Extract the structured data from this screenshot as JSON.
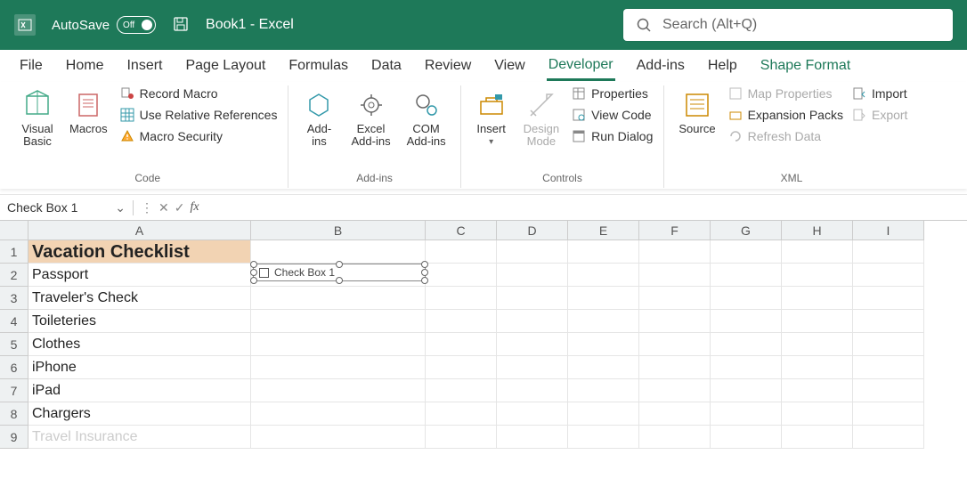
{
  "titlebar": {
    "autosave_label": "AutoSave",
    "autosave_state": "Off",
    "doc_name": "Book1",
    "app_name": "Excel",
    "separator": " - "
  },
  "search": {
    "placeholder": "Search (Alt+Q)"
  },
  "tabs": {
    "file": "File",
    "home": "Home",
    "insert": "Insert",
    "page_layout": "Page Layout",
    "formulas": "Formulas",
    "data": "Data",
    "review": "Review",
    "view": "View",
    "developer": "Developer",
    "addins": "Add-ins",
    "help": "Help",
    "shape_format": "Shape Format"
  },
  "ribbon": {
    "code": {
      "visual_basic": "Visual\nBasic",
      "macros": "Macros",
      "record_macro": "Record Macro",
      "use_relative": "Use Relative References",
      "macro_security": "Macro Security",
      "group": "Code"
    },
    "addins": {
      "addins": "Add-\nins",
      "excel_addins": "Excel\nAdd-ins",
      "com_addins": "COM\nAdd-ins",
      "group": "Add-ins"
    },
    "controls": {
      "insert": "Insert",
      "design_mode": "Design\nMode",
      "properties": "Properties",
      "view_code": "View Code",
      "run_dialog": "Run Dialog",
      "group": "Controls"
    },
    "xml": {
      "source": "Source",
      "map_properties": "Map Properties",
      "expansion_packs": "Expansion Packs",
      "refresh_data": "Refresh Data",
      "import": "Import",
      "export": "Export",
      "group": "XML"
    }
  },
  "namebox": {
    "value": "Check Box 1"
  },
  "columns": [
    "A",
    "B",
    "C",
    "D",
    "E",
    "F",
    "G",
    "H",
    "I"
  ],
  "rows": [
    {
      "num": "1",
      "a": "Vacation Checklist",
      "title": true
    },
    {
      "num": "2",
      "a": "Passport"
    },
    {
      "num": "3",
      "a": "Traveler's Check"
    },
    {
      "num": "4",
      "a": "Toileteries"
    },
    {
      "num": "5",
      "a": "Clothes"
    },
    {
      "num": "6",
      "a": "iPhone"
    },
    {
      "num": "7",
      "a": "iPad"
    },
    {
      "num": "8",
      "a": "Chargers"
    },
    {
      "num": "9",
      "a": "Travel Insurance",
      "faded": true
    }
  ],
  "shape": {
    "label": "Check Box 1"
  }
}
